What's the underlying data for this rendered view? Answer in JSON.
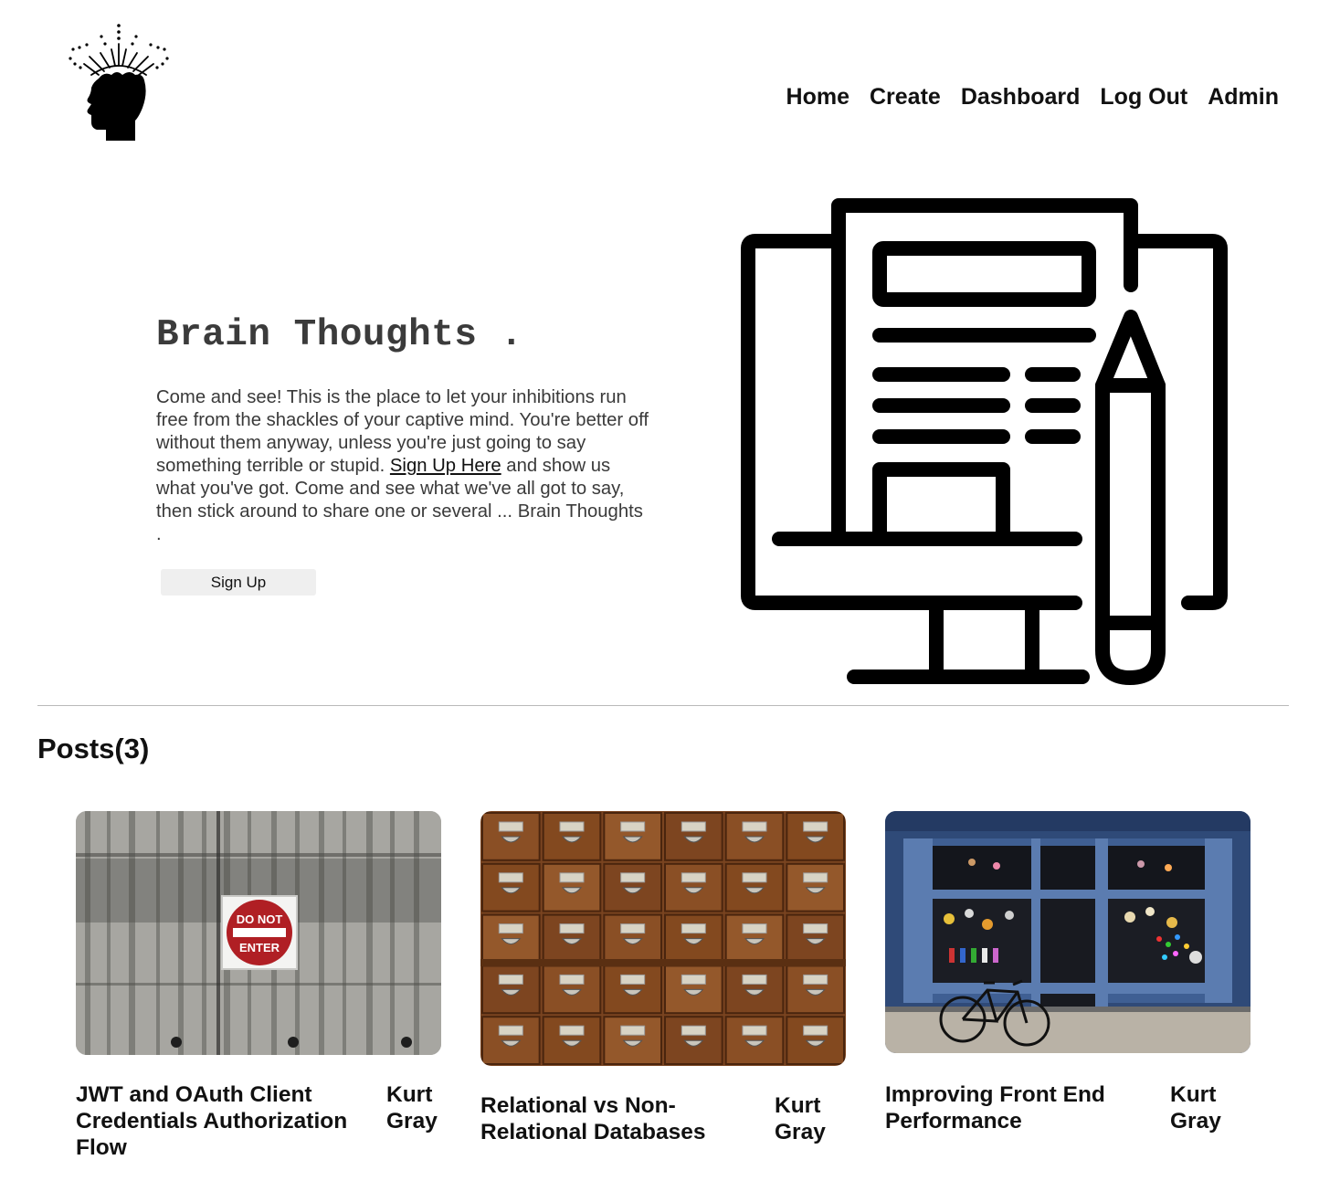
{
  "nav": {
    "items": [
      "Home",
      "Create",
      "Dashboard",
      "Log Out",
      "Admin"
    ]
  },
  "hero": {
    "title": "Brain Thoughts .",
    "text_before_link": "Come and see! This is the place to let your inhibitions run free from the shackles of your captive mind. You're better off without them anyway, unless you're just going to say something terrible or stupid. ",
    "link_label": "Sign Up Here",
    "text_after_link": " and show us what you've got. Come and see what we've all got to say, then stick around to share one or several ... Brain Thoughts .",
    "button_label": "Sign Up"
  },
  "posts": {
    "heading": "Posts(3)",
    "items": [
      {
        "title": "JWT and OAuth Client Credentials Authorization Flow",
        "author": "Kurt Gray",
        "image": "do-not-enter-sign-photo"
      },
      {
        "title": "Relational vs Non-Relational Databases",
        "author": "Kurt Gray",
        "image": "card-catalog-drawers-photo"
      },
      {
        "title": "Improving Front End Performance",
        "author": "Kurt Gray",
        "image": "shop-front-bicycle-photo"
      }
    ]
  }
}
